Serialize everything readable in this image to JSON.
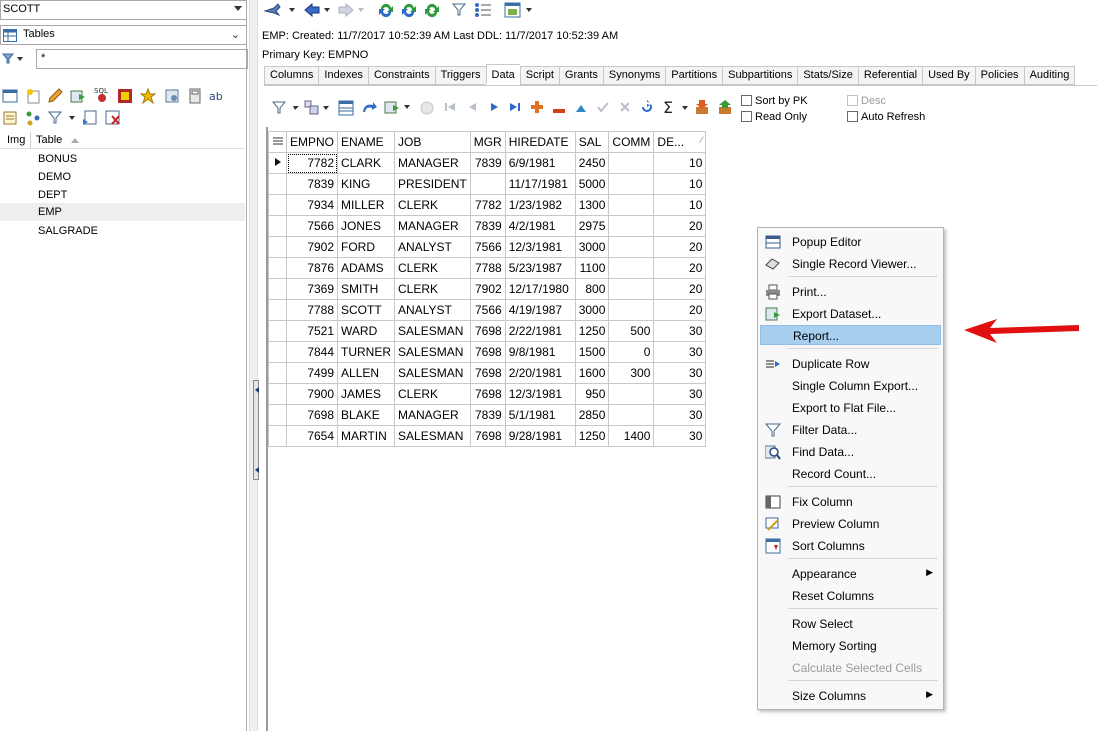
{
  "left": {
    "schema_combo": "SCOTT",
    "type_combo": "Tables",
    "filter_value": "*",
    "columns": {
      "img": "Img",
      "table": "Table"
    },
    "tables": [
      "BONUS",
      "DEMO",
      "DEPT",
      "EMP",
      "SALGRADE"
    ],
    "selected_table": "EMP"
  },
  "info": {
    "created": "EMP:  Created: 11/7/2017 10:52:39 AM   Last DDL: 11/7/2017 10:52:39 AM",
    "primary_key": "Primary Key:  EMPNO"
  },
  "tabs": [
    "Columns",
    "Indexes",
    "Constraints",
    "Triggers",
    "Data",
    "Script",
    "Grants",
    "Synonyms",
    "Partitions",
    "Subpartitions",
    "Stats/Size",
    "Referential",
    "Used By",
    "Policies",
    "Auditing"
  ],
  "active_tab": "Data",
  "options": {
    "sort_by_pk": "Sort by PK",
    "read_only": "Read Only",
    "desc": "Desc",
    "auto_refresh": "Auto Refresh"
  },
  "grid": {
    "columns": [
      "EMPNO",
      "ENAME",
      "JOB",
      "MGR",
      "HIREDATE",
      "SAL",
      "COMM",
      "DE..."
    ],
    "rows": [
      [
        "7782",
        "CLARK",
        "MANAGER",
        "7839",
        "6/9/1981",
        "2450",
        "",
        "10"
      ],
      [
        "7839",
        "KING",
        "PRESIDENT",
        "",
        "11/17/1981",
        "5000",
        "",
        "10"
      ],
      [
        "7934",
        "MILLER",
        "CLERK",
        "7782",
        "1/23/1982",
        "1300",
        "",
        "10"
      ],
      [
        "7566",
        "JONES",
        "MANAGER",
        "7839",
        "4/2/1981",
        "2975",
        "",
        "20"
      ],
      [
        "7902",
        "FORD",
        "ANALYST",
        "7566",
        "12/3/1981",
        "3000",
        "",
        "20"
      ],
      [
        "7876",
        "ADAMS",
        "CLERK",
        "7788",
        "5/23/1987",
        "1100",
        "",
        "20"
      ],
      [
        "7369",
        "SMITH",
        "CLERK",
        "7902",
        "12/17/1980",
        "800",
        "",
        "20"
      ],
      [
        "7788",
        "SCOTT",
        "ANALYST",
        "7566",
        "4/19/1987",
        "3000",
        "",
        "20"
      ],
      [
        "7521",
        "WARD",
        "SALESMAN",
        "7698",
        "2/22/1981",
        "1250",
        "500",
        "30"
      ],
      [
        "7844",
        "TURNER",
        "SALESMAN",
        "7698",
        "9/8/1981",
        "1500",
        "0",
        "30"
      ],
      [
        "7499",
        "ALLEN",
        "SALESMAN",
        "7698",
        "2/20/1981",
        "1600",
        "300",
        "30"
      ],
      [
        "7900",
        "JAMES",
        "CLERK",
        "7698",
        "12/3/1981",
        "950",
        "",
        "30"
      ],
      [
        "7698",
        "BLAKE",
        "MANAGER",
        "7839",
        "5/1/1981",
        "2850",
        "",
        "30"
      ],
      [
        "7654",
        "MARTIN",
        "SALESMAN",
        "7698",
        "9/28/1981",
        "1250",
        "1400",
        "30"
      ]
    ]
  },
  "menu": {
    "items": [
      {
        "label": "Popup Editor",
        "icon": "grid-editor-icon"
      },
      {
        "label": "Single Record Viewer...",
        "icon": "eraser-icon"
      },
      {
        "label": "Print...",
        "icon": "printer-icon"
      },
      {
        "label": "Export Dataset...",
        "icon": "export-icon"
      },
      {
        "label": "Report...",
        "icon": "",
        "highlighted": true
      },
      {
        "label": "Duplicate Row",
        "icon": "duplicate-row-icon"
      },
      {
        "label": "Single Column Export...",
        "icon": ""
      },
      {
        "label": "Export to Flat File...",
        "icon": ""
      },
      {
        "label": "Filter Data...",
        "icon": "filter-icon"
      },
      {
        "label": "Find Data...",
        "icon": "find-icon"
      },
      {
        "label": "Record Count...",
        "icon": ""
      },
      {
        "label": "Fix Column",
        "icon": "fix-column-icon"
      },
      {
        "label": "Preview Column",
        "icon": "preview-column-icon"
      },
      {
        "label": "Sort Columns",
        "icon": "sort-columns-icon"
      },
      {
        "label": "Appearance",
        "icon": "",
        "submenu": true
      },
      {
        "label": "Reset Columns",
        "icon": ""
      },
      {
        "label": "Row Select",
        "icon": ""
      },
      {
        "label": "Memory Sorting",
        "icon": ""
      },
      {
        "label": "Calculate Selected Cells",
        "icon": "",
        "disabled": true
      },
      {
        "label": "Size Columns",
        "icon": "",
        "submenu": true
      }
    ]
  },
  "colors": {
    "highlight": "#a8cff0",
    "arrow": "#e01010"
  }
}
